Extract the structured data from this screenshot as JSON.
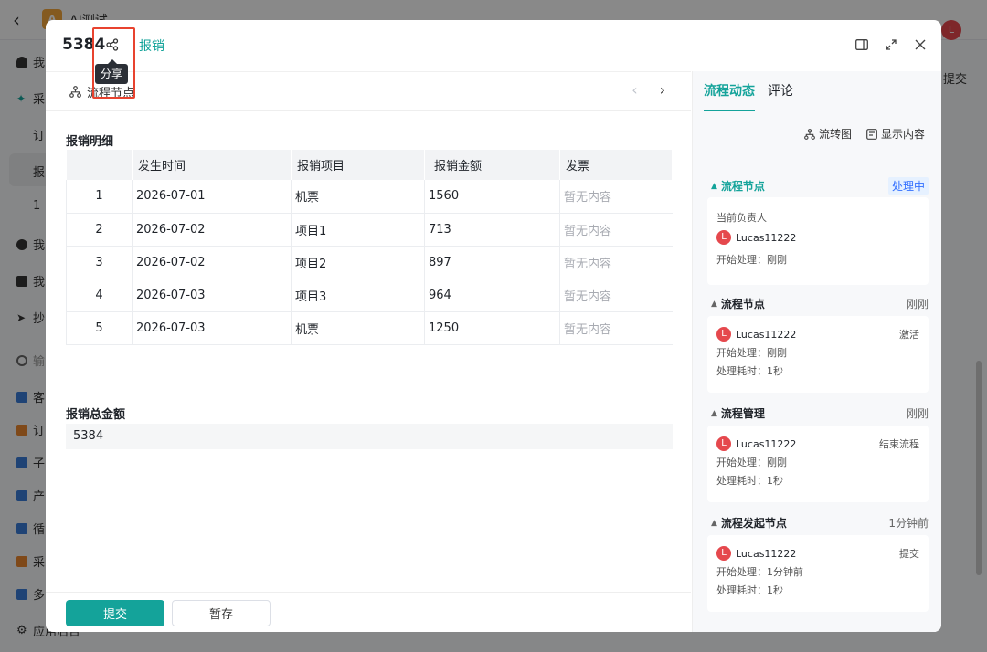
{
  "background": {
    "app_title": "AI测试",
    "avatar_letter": "L",
    "sidebar_items": [
      "我",
      "采",
      "订",
      "报",
      "1",
      "我",
      "我",
      "抄",
      "输",
      "客",
      "订",
      "子",
      "产",
      "循",
      "采",
      "多",
      "应用后台"
    ],
    "right_fragments": [
      "提交"
    ]
  },
  "modal": {
    "title": "5384",
    "form_tag": "报销",
    "share_tooltip": "分享",
    "node_label": "流程节点",
    "section_detail_title": "报销明细",
    "table": {
      "headers": [
        "",
        "发生时间",
        "报销项目",
        "报销金额",
        "发票"
      ],
      "rows": [
        {
          "no": "1",
          "date": "2026-07-01",
          "item": "机票",
          "amount": "1560",
          "invoice": "暂无内容"
        },
        {
          "no": "2",
          "date": "2026-07-02",
          "item": "项目1",
          "amount": "713",
          "invoice": "暂无内容"
        },
        {
          "no": "3",
          "date": "2026-07-02",
          "item": "项目2",
          "amount": "897",
          "invoice": "暂无内容"
        },
        {
          "no": "4",
          "date": "2026-07-03",
          "item": "项目3",
          "amount": "964",
          "invoice": "暂无内容"
        },
        {
          "no": "5",
          "date": "2026-07-03",
          "item": "机票",
          "amount": "1250",
          "invoice": "暂无内容"
        }
      ]
    },
    "section_total_title": "报销总金额",
    "total_value": "5384",
    "submit_label": "提交",
    "draft_label": "暂存"
  },
  "side": {
    "tab_flow": "流程动态",
    "tab_comment": "评论",
    "tool_flowchart": "流转图",
    "tool_show_content": "显示内容",
    "current": {
      "name": "流程节点",
      "status": "处理中",
      "owner_label": "当前负责人",
      "user": "Lucas11222",
      "avatar": "L",
      "start": "开始处理：刚刚"
    },
    "steps": [
      {
        "name": "流程节点",
        "time": "刚刚",
        "user": "Lucas11222",
        "avatar": "L",
        "action": "激活",
        "start": "开始处理：刚刚",
        "duration": "处理耗时：1秒"
      },
      {
        "name": "流程管理",
        "time": "刚刚",
        "user": "Lucas11222",
        "avatar": "L",
        "action": "结束流程",
        "start": "开始处理：刚刚",
        "duration": "处理耗时：1秒"
      },
      {
        "name": "流程发起节点",
        "time": "1分钟前",
        "user": "Lucas11222",
        "avatar": "L",
        "action": "提交",
        "start": "开始处理：1分钟前",
        "duration": "处理耗时：1秒"
      }
    ]
  },
  "colors": {
    "accent": "#14a39a",
    "highlight": "#e8432f",
    "avatar": "#e5484d",
    "processing": "#3370ff"
  }
}
